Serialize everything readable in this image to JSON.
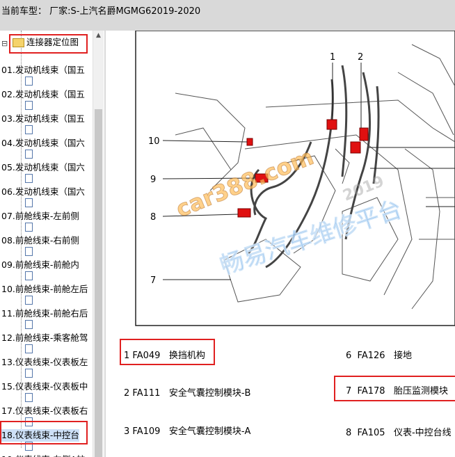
{
  "titlebar": {
    "label": "当前车型：",
    "vendor_label": "厂家:S-上汽名爵MGMG62019-2020"
  },
  "sidebar": {
    "partial_top": "...",
    "folder": {
      "label": "连接器定位图"
    },
    "items": [
      {
        "label": "01.发动机线束（国五"
      },
      {
        "label": "02.发动机线束（国五"
      },
      {
        "label": "03.发动机线束（国五"
      },
      {
        "label": "04.发动机线束（国六"
      },
      {
        "label": "05.发动机线束（国六"
      },
      {
        "label": "06.发动机线束（国六"
      },
      {
        "label": "07.前舱线束-左前侧"
      },
      {
        "label": "08.前舱线束-右前侧"
      },
      {
        "label": "09.前舱线束-前舱内"
      },
      {
        "label": "10.前舱线束-前舱左后"
      },
      {
        "label": "11.前舱线束-前舱右后"
      },
      {
        "label": "12.前舱线束-乘客舱驾"
      },
      {
        "label": "13.仪表线束-仪表板左"
      },
      {
        "label": "15.仪表线束-仪表板中"
      },
      {
        "label": "17.仪表线束-仪表板右"
      },
      {
        "label": "18.仪表线束-中控台"
      },
      {
        "label": "19.仪表线束-左侧A柱"
      }
    ]
  },
  "diagram": {
    "callouts": [
      "1",
      "2",
      "10",
      "9",
      "8",
      "7"
    ]
  },
  "legend": [
    {
      "num": "1",
      "code": "FA049",
      "desc": "换挡机构"
    },
    {
      "num": "6",
      "code": "FA126",
      "desc": "接地"
    },
    {
      "num": "2",
      "code": "FA111",
      "desc": "安全气囊控制模块-B"
    },
    {
      "num": "7",
      "code": "FA178",
      "desc": "胎压监测模块"
    },
    {
      "num": "3",
      "code": "FA109",
      "desc": "安全气囊控制模块-A"
    },
    {
      "num": "8",
      "code": "FA105",
      "desc": "仪表-中控台线"
    }
  ],
  "watermark": {
    "site": "car388.com",
    "slogan": "畅易汽车维修平台",
    "year": "2019"
  },
  "colors": {
    "highlight": "#e02020",
    "connector": "#e01010",
    "selected_bg": "#cde0f7"
  }
}
